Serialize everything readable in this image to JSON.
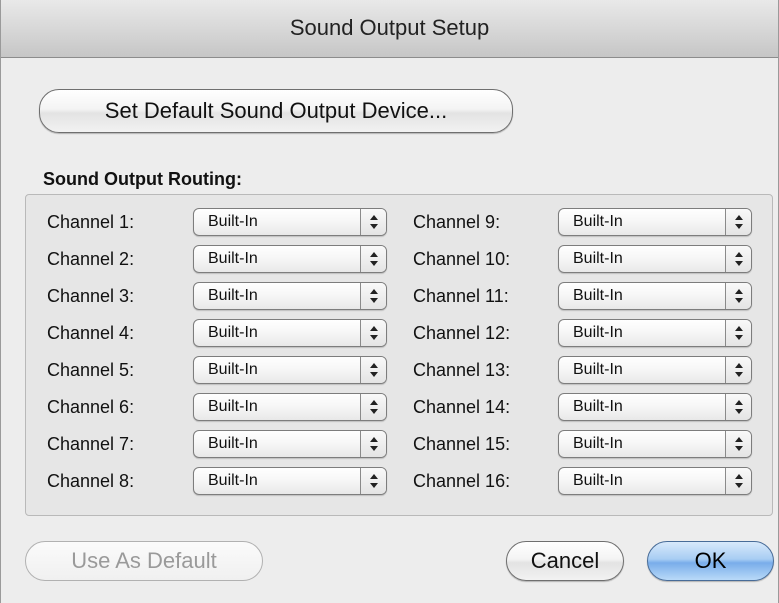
{
  "window": {
    "title": "Sound Output Setup"
  },
  "buttons": {
    "set_default": "Set Default Sound Output Device...",
    "use_as_default": "Use As Default",
    "cancel": "Cancel",
    "ok": "OK"
  },
  "routing": {
    "label": "Sound Output Routing:",
    "channels": [
      {
        "label": "Channel 1:",
        "value": "Built-In"
      },
      {
        "label": "Channel 2:",
        "value": "Built-In"
      },
      {
        "label": "Channel 3:",
        "value": "Built-In"
      },
      {
        "label": "Channel 4:",
        "value": "Built-In"
      },
      {
        "label": "Channel 5:",
        "value": "Built-In"
      },
      {
        "label": "Channel 6:",
        "value": "Built-In"
      },
      {
        "label": "Channel 7:",
        "value": "Built-In"
      },
      {
        "label": "Channel 8:",
        "value": "Built-In"
      },
      {
        "label": "Channel 9:",
        "value": "Built-In"
      },
      {
        "label": "Channel 10:",
        "value": "Built-In"
      },
      {
        "label": "Channel 11:",
        "value": "Built-In"
      },
      {
        "label": "Channel 12:",
        "value": "Built-In"
      },
      {
        "label": "Channel 13:",
        "value": "Built-In"
      },
      {
        "label": "Channel 14:",
        "value": "Built-In"
      },
      {
        "label": "Channel 15:",
        "value": "Built-In"
      },
      {
        "label": "Channel 16:",
        "value": "Built-In"
      }
    ]
  },
  "icons": {
    "select_arrow": "up-down-chevron-icon"
  },
  "colors": {
    "default_button": "#79adea",
    "disabled_text": "#9a9a9a"
  }
}
